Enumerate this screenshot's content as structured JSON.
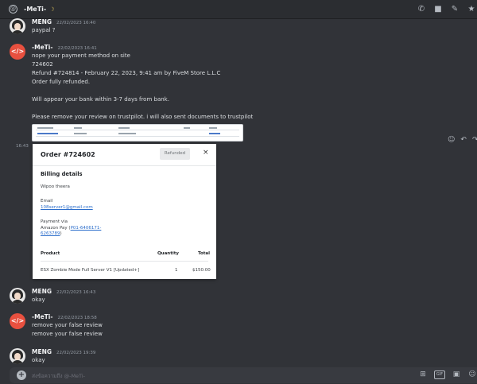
{
  "channel": {
    "title": "-MeTi-",
    "moon": "☽"
  },
  "toolbar_icons": [
    "at-icon",
    "phone-icon",
    "video-icon",
    "pin-icon",
    "star-icon"
  ],
  "messages": [
    {
      "user": "MENG",
      "time": "22/02/2023 16:40",
      "lines": [
        "paypal ?"
      ]
    },
    {
      "user": "-MeTi-",
      "time": "22/02/2023 16:41",
      "lines": [
        "nope your payment method on site",
        "724602",
        "Refund #724814 - February 22, 2023, 9:41 am by FiveM Store L.L.C",
        "Order fully refunded.",
        "",
        "Will appear your bank within 3-7 days from bank.",
        "",
        "Please remove your review on trustpilot. i will also sent documents to trustpilot"
      ]
    },
    {
      "user": "MENG",
      "time": "22/02/2023 16:43",
      "lines": [
        "okay"
      ]
    },
    {
      "user": "-MeTi-",
      "time": "22/02/2023 18:58",
      "lines": [
        "remove your false review",
        "remove your false review"
      ]
    },
    {
      "user": "MENG",
      "time": "22/02/2023 19:39",
      "lines": [
        "okay"
      ]
    }
  ],
  "side_time": "16:43",
  "order": {
    "title": "Order #724602",
    "status": "Refunded",
    "close": "×",
    "section": "Billing details",
    "name": "Wipoo theera",
    "email_label": "Email",
    "email": "108server1@gmail.com",
    "payment_label": "Payment via",
    "payment_method": "Amazon Pay",
    "payment_ref_open": "(",
    "payment_ref": "P01-6406171-",
    "payment_ref2": "6263789",
    "payment_ref_close": ")",
    "headers": {
      "product": "Product",
      "quantity": "Quantity",
      "total": "Total"
    },
    "item": {
      "product": "ESX Zombie Mode Full Server V1 [Updated+]",
      "quantity": "1",
      "total": "$150.00"
    }
  },
  "input": {
    "placeholder": "ส่งข้อความถึง @-MeTi-"
  },
  "colors": {
    "bg": "#313338",
    "accent_meti": "#e8503f"
  }
}
